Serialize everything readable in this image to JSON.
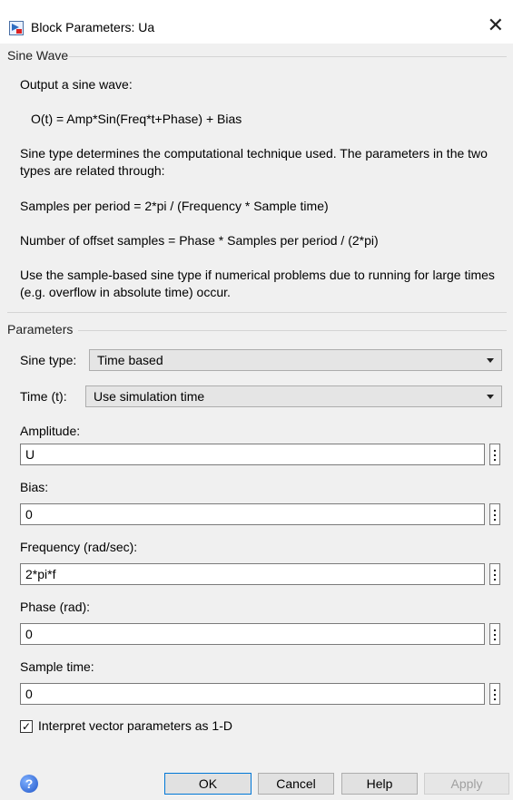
{
  "window": {
    "title": "Block Parameters: Ua",
    "close_glyph": "✕",
    "icon": "simulink-block-icon"
  },
  "description": {
    "group_title": "Sine Wave",
    "line1": "Output a sine wave:",
    "formula": "O(t) = Amp*Sin(Freq*t+Phase) + Bias",
    "para1": "Sine type determines the computational technique used. The parameters in the two types are related through:",
    "eq1": "Samples per period = 2*pi / (Frequency * Sample time)",
    "eq2": "Number of offset samples = Phase * Samples per period / (2*pi)",
    "para2": "Use the sample-based sine type if numerical problems due to running for large times (e.g. overflow in absolute time) occur."
  },
  "parameters": {
    "group_title": "Parameters",
    "sine_type": {
      "label": "Sine type:",
      "value": "Time based"
    },
    "time": {
      "label": "Time (t):",
      "value": "Use simulation time"
    },
    "amplitude": {
      "label": "Amplitude:",
      "value": "U"
    },
    "bias": {
      "label": "Bias:",
      "value": "0"
    },
    "frequency": {
      "label": "Frequency (rad/sec):",
      "value": "2*pi*f"
    },
    "phase": {
      "label": "Phase (rad):",
      "value": "0"
    },
    "sample_time": {
      "label": "Sample time:",
      "value": "0"
    },
    "interpret_vector": {
      "label": "Interpret vector parameters as 1-D",
      "checked": true
    }
  },
  "buttons": {
    "help_icon": "?",
    "ok": "OK",
    "cancel": "Cancel",
    "help": "Help",
    "apply": "Apply"
  },
  "colors": {
    "panel_bg": "#f0f0f0",
    "accent": "#0078d7"
  }
}
